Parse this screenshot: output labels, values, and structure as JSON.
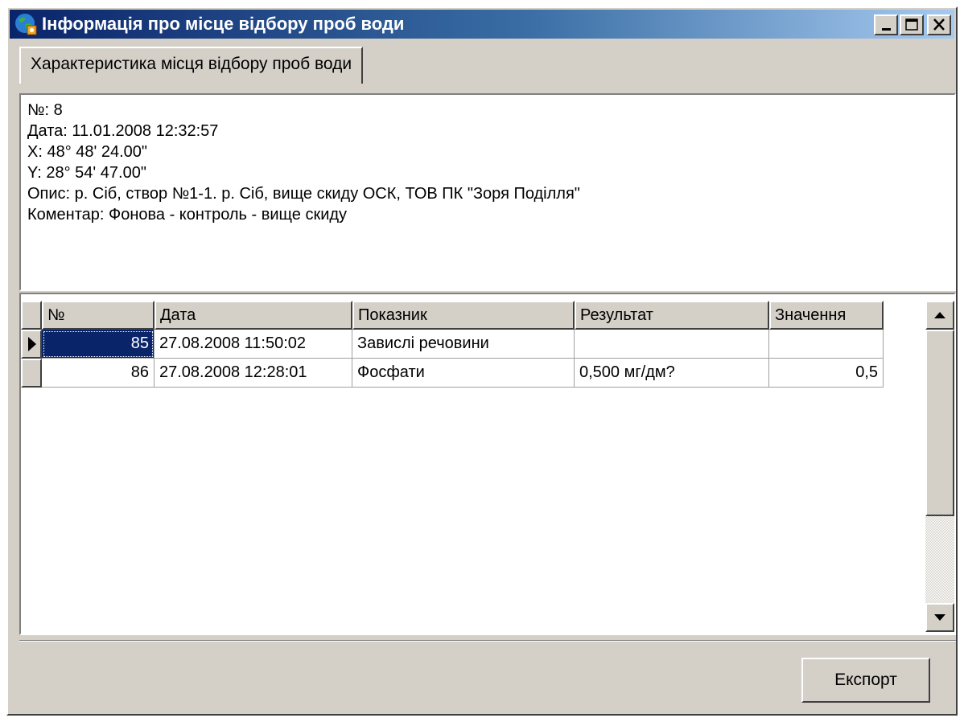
{
  "window": {
    "title": "Інформація про місце відбору проб води",
    "icon": "globe-app-icon"
  },
  "title_buttons": {
    "minimize": "minimize-icon",
    "maximize": "maximize-icon",
    "close": "close-icon"
  },
  "tab": {
    "label": "Характеристика місця відбору проб води"
  },
  "info": {
    "lines": [
      "№: 8",
      "Дата: 11.01.2008 12:32:57",
      "X: 48° 48' 24.00\"",
      "Y: 28° 54' 47.00\"",
      "Опис: р. Сіб, створ №1-1. р. Сіб, вище скиду ОСК, ТОВ ПК \"Зоря Поділля\"",
      "Коментар: Фонова - контроль - вище скиду"
    ]
  },
  "grid": {
    "columns": [
      "№",
      "Дата",
      "Показник",
      "Результат",
      "Значення"
    ],
    "rows": [
      {
        "num": "85",
        "date": "27.08.2008 11:50:02",
        "indicator": "Завислі речовини",
        "result": "",
        "value": "",
        "selected": true
      },
      {
        "num": "86",
        "date": "27.08.2008 12:28:01",
        "indicator": "Фосфати",
        "result": "0,500 мг/дм?",
        "value": "0,5",
        "selected": false
      }
    ]
  },
  "footer": {
    "export_label": "Експорт"
  },
  "colors": {
    "title_start": "#0a246a",
    "title_end": "#a6caf0",
    "selection": "#0a246a",
    "face": "#d4d0c8"
  }
}
